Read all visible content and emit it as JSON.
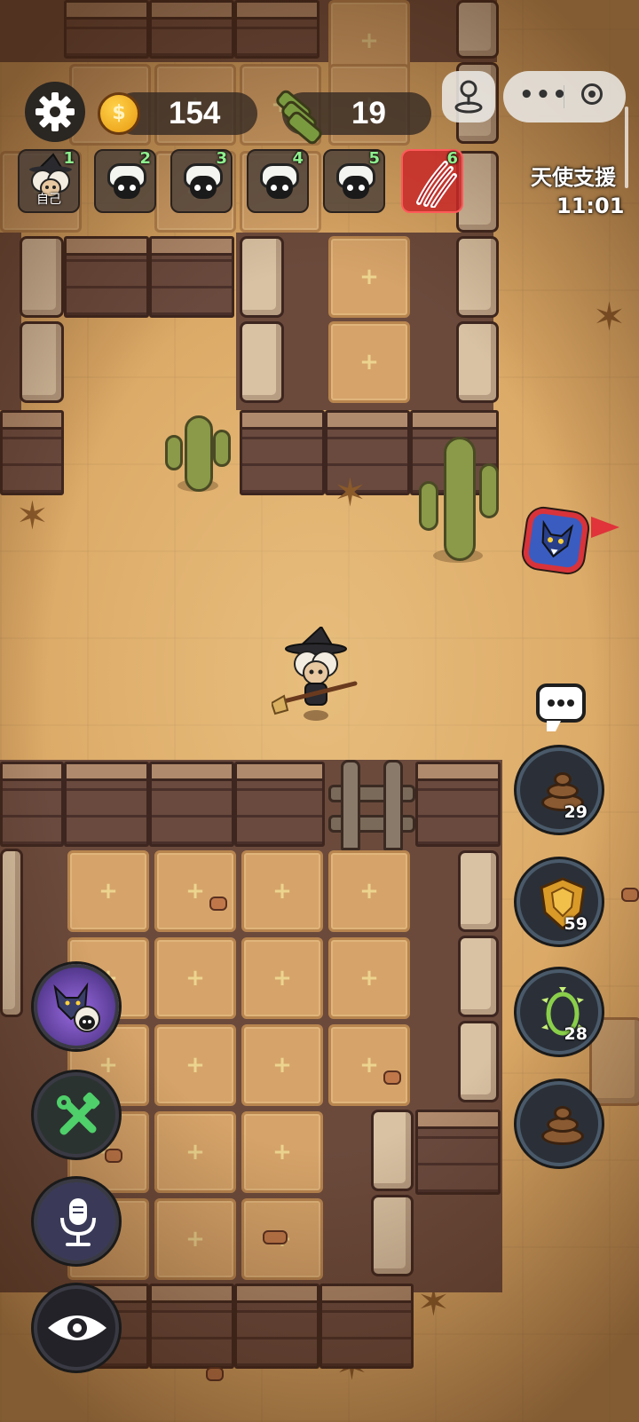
{
  "hud": {
    "coins": "154",
    "wood": "19",
    "coin_symbol": "$"
  },
  "team_slots": [
    {
      "number": "1",
      "label": "自己"
    },
    {
      "number": "2"
    },
    {
      "number": "3"
    },
    {
      "number": "4"
    },
    {
      "number": "5"
    },
    {
      "number": "6"
    }
  ],
  "event": {
    "title": "天使支援",
    "time": "11:01"
  },
  "skills": [
    {
      "icon": "poop-icon",
      "count": "29"
    },
    {
      "icon": "shield-icon",
      "count": "59"
    },
    {
      "icon": "thorn-ring-icon",
      "count": "28"
    },
    {
      "icon": "poop-icon",
      "count": ""
    }
  ],
  "colors": {
    "ground": "#dba865",
    "wall": "#6a4a3e",
    "alert_red": "#d8333a",
    "slot_number_green": "#8ef08e"
  }
}
